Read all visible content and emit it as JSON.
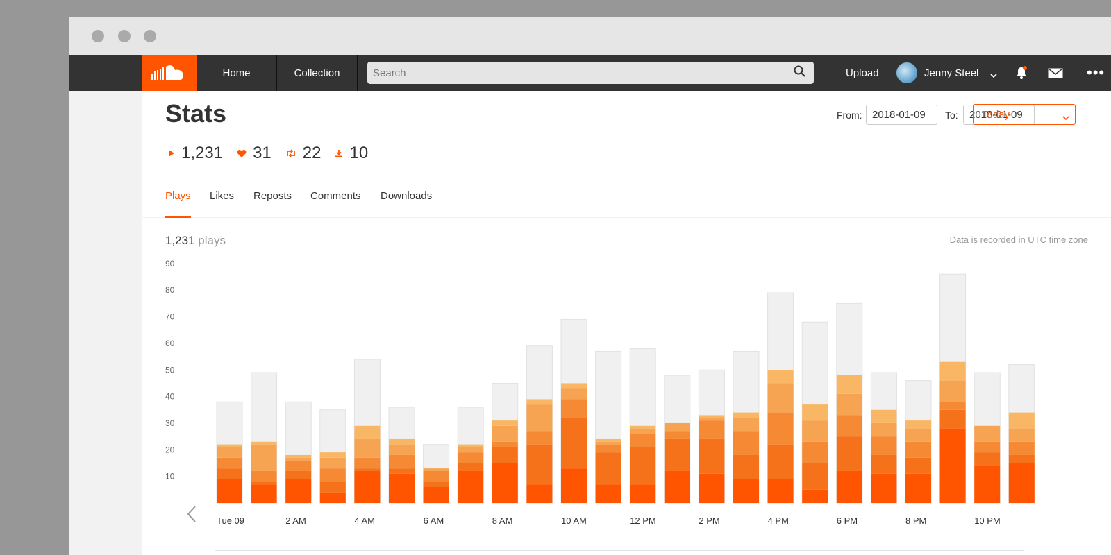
{
  "navbar": {
    "home_label": "Home",
    "collection_label": "Collection",
    "search_placeholder": "Search",
    "upload_label": "Upload",
    "username": "Jenny Steel"
  },
  "stats": {
    "title": "Stats",
    "from_label": "From:",
    "from_value": "2018-01-09",
    "to_label": "To:",
    "to_value": "2018-01-09",
    "range_label": "Today",
    "plays": "1,231",
    "likes": "31",
    "reposts": "22",
    "downloads": "10"
  },
  "tabs": [
    "Plays",
    "Likes",
    "Reposts",
    "Comments",
    "Downloads"
  ],
  "summary": {
    "count": "1,231",
    "unit": "plays",
    "utc_note": "Data is recorded in UTC time zone"
  },
  "colors": {
    "accent": "#ff5500",
    "navbar": "#333333",
    "stack": [
      "#ff5500",
      "#f5711a",
      "#f68a34",
      "#f7a452",
      "#f9b766",
      "#f0f0f0"
    ]
  },
  "chart_data": {
    "type": "bar",
    "stacked": true,
    "ylim": [
      0,
      90
    ],
    "yticks": [
      10,
      20,
      30,
      40,
      50,
      60,
      70,
      80,
      90
    ],
    "x_tick_labels": [
      "Tue 09",
      "2 AM",
      "4 AM",
      "6 AM",
      "8 AM",
      "10 AM",
      "12 PM",
      "2 PM",
      "4 PM",
      "6 PM",
      "8 PM",
      "10 PM"
    ],
    "grid": false,
    "totals": [
      38,
      49,
      38,
      35,
      54,
      36,
      22,
      36,
      45,
      59,
      69,
      57,
      58,
      48,
      50,
      57,
      79,
      68,
      75,
      49,
      46,
      86,
      49,
      52
    ],
    "stacks": [
      [
        9,
        4,
        4,
        4,
        1
      ],
      [
        7,
        1,
        4,
        10,
        1
      ],
      [
        9,
        3,
        4,
        1,
        1
      ],
      [
        4,
        4,
        5,
        4,
        2
      ],
      [
        12,
        1,
        4,
        7,
        5
      ],
      [
        11,
        2,
        5,
        4,
        2
      ],
      [
        6,
        2,
        4,
        1,
        0
      ],
      [
        12,
        3,
        4,
        2,
        1
      ],
      [
        15,
        6,
        2,
        6,
        2
      ],
      [
        7,
        15,
        5,
        10,
        2
      ],
      [
        13,
        19,
        7,
        4,
        2
      ],
      [
        7,
        12,
        3,
        1,
        1
      ],
      [
        7,
        14,
        5,
        2,
        1
      ],
      [
        12,
        12,
        3,
        3,
        0
      ],
      [
        11,
        13,
        7,
        1,
        1
      ],
      [
        9,
        9,
        9,
        5,
        2
      ],
      [
        9,
        13,
        12,
        11,
        5
      ],
      [
        5,
        10,
        8,
        8,
        6
      ],
      [
        12,
        13,
        8,
        8,
        7
      ],
      [
        11,
        7,
        7,
        5,
        5
      ],
      [
        11,
        6,
        6,
        5,
        3
      ],
      [
        28,
        7,
        3,
        8,
        7
      ],
      [
        14,
        5,
        4,
        6,
        0
      ],
      [
        15,
        3,
        5,
        5,
        6
      ]
    ]
  }
}
